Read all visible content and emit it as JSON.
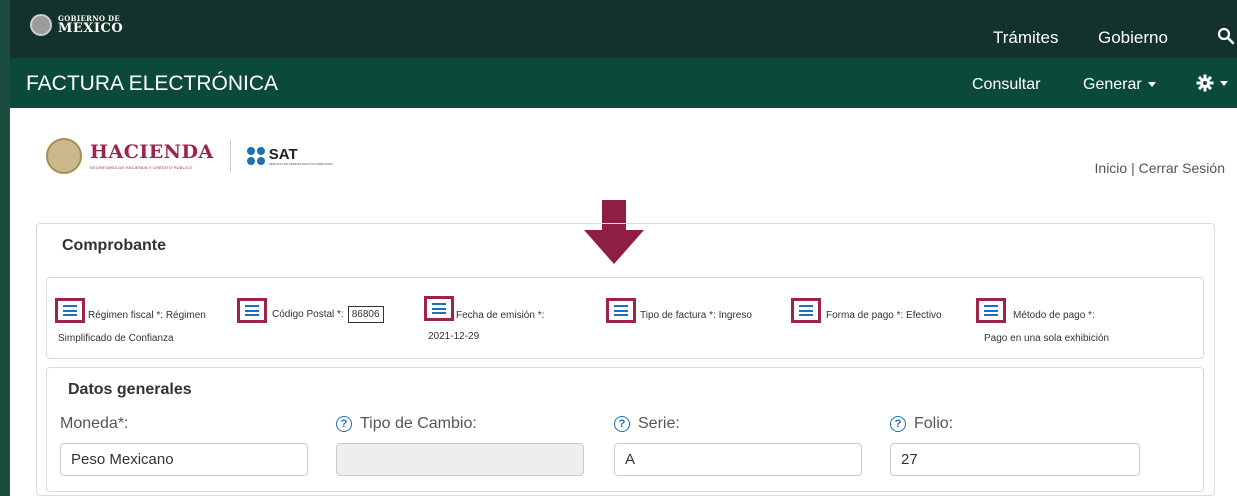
{
  "topbar": {
    "logo_line1": "GOBIERNO DE",
    "logo_line2": "MÉXICO",
    "nav": [
      "Trámites",
      "Gobierno"
    ],
    "search_icon": "search-icon"
  },
  "subbar": {
    "title": "FACTURA ELECTRÓNICA",
    "consultar": "Consultar",
    "generar": "Generar",
    "settings_icon": "gear-icon"
  },
  "branding": {
    "hacienda": "HACIENDA",
    "hacienda_sub": "SECRETARÍA DE HACIENDA Y CRÉDITO PÚBLICO",
    "sat": "SAT",
    "sat_sub": "SERVICIO DE ADMINISTRACIÓN TRIBUTARIA"
  },
  "session": {
    "inicio": "Inicio",
    "separator": " | ",
    "cerrar": "Cerrar Sesión"
  },
  "comprobante": {
    "title": "Comprobante",
    "regimen_label": "Régimen fiscal *:",
    "regimen_value_1": "Régimen",
    "regimen_value_2": "Simplificado de Confianza",
    "cp_label": "Código Postal *:",
    "cp_value": "86806",
    "fecha_label": "Fecha de emisión *:",
    "fecha_value": "2021-12-29",
    "tipo_label": "Tipo de factura *:",
    "tipo_value": "Ingreso",
    "forma_label": "Forma de pago *:",
    "forma_value": "Efectivo",
    "metodo_label": "Método de pago *:",
    "metodo_value": "Pago en una sola exhibición"
  },
  "datos": {
    "title": "Datos generales",
    "moneda_label": "Moneda*:",
    "moneda_value": "Peso Mexicano",
    "tipo_cambio_label": "Tipo de Cambio:",
    "tipo_cambio_value": "",
    "serie_label": "Serie:",
    "serie_value": "A",
    "folio_label": "Folio:",
    "folio_value": "27"
  },
  "colors": {
    "topbar": "#13322b",
    "subbar": "#0b4a3a",
    "accent": "#9d2449",
    "icon_blue": "#1f70b5"
  }
}
